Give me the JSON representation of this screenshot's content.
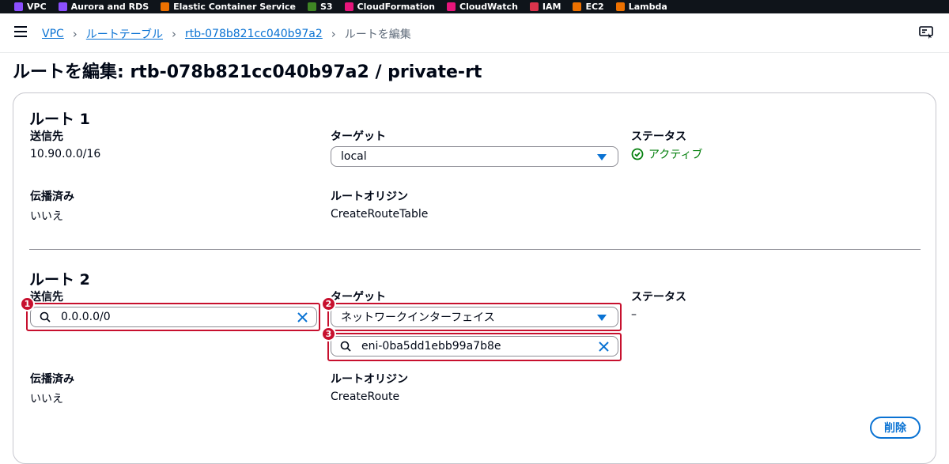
{
  "favorites": [
    {
      "label": "VPC",
      "color": "#8c4fff",
      "icon": "vpc-icon"
    },
    {
      "label": "Aurora and RDS",
      "color": "#8c4fff",
      "icon": "rds-icon"
    },
    {
      "label": "Elastic Container Service",
      "color": "#ed7100",
      "icon": "ecs-icon"
    },
    {
      "label": "S3",
      "color": "#3f8624",
      "icon": "s3-icon"
    },
    {
      "label": "CloudFormation",
      "color": "#e7157b",
      "icon": "cloudformation-icon"
    },
    {
      "label": "CloudWatch",
      "color": "#e7157b",
      "icon": "cloudwatch-icon"
    },
    {
      "label": "IAM",
      "color": "#dd344c",
      "icon": "iam-icon"
    },
    {
      "label": "EC2",
      "color": "#ed7100",
      "icon": "ec2-icon"
    },
    {
      "label": "Lambda",
      "color": "#ed7100",
      "icon": "lambda-icon"
    }
  ],
  "breadcrumb": {
    "items": [
      "VPC",
      "ルートテーブル",
      "rtb-078b821cc040b97a2"
    ],
    "current": "ルートを編集"
  },
  "page_title": "ルートを編集: rtb-078b821cc040b97a2 / private-rt",
  "routes": [
    {
      "heading": "ルート 1",
      "destination_label": "送信先",
      "destination": "10.90.0.0/16",
      "target_label": "ターゲット",
      "target": "local",
      "status_label": "ステータス",
      "status": "アクティブ",
      "propagated_label": "伝播済み",
      "propagated": "いいえ",
      "origin_label": "ルートオリジン",
      "origin": "CreateRouteTable"
    },
    {
      "heading": "ルート 2",
      "destination_label": "送信先",
      "destination": "0.0.0.0/0",
      "target_label": "ターゲット",
      "target": "ネットワークインターフェイス",
      "target_id": "eni-0ba5dd1ebb99a7b8e",
      "status_label": "ステータス",
      "status": "–",
      "propagated_label": "伝播済み",
      "propagated": "いいえ",
      "origin_label": "ルートオリジン",
      "origin": "CreateRoute"
    }
  ],
  "markers": [
    "1",
    "2",
    "3"
  ],
  "delete_label": "削除",
  "colors": {
    "link": "#0972d3",
    "highlight": "#c7102e",
    "success": "#037f0c",
    "topbar": "#0f141a"
  }
}
